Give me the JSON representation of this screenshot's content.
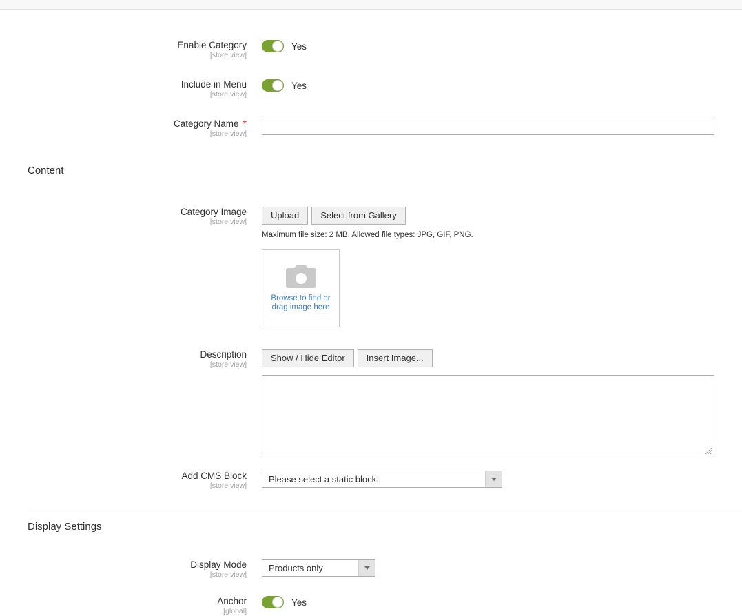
{
  "scopes": {
    "store_view": "[store view]",
    "global": "[global]"
  },
  "fields": {
    "enable_category": {
      "label": "Enable Category",
      "scope": "[store view]",
      "value": "Yes",
      "toggle_color": "#79a22e"
    },
    "include_in_menu": {
      "label": "Include in Menu",
      "scope": "[store view]",
      "value": "Yes",
      "toggle_color": "#79a22e"
    },
    "category_name": {
      "label": "Category Name",
      "scope": "[store view]",
      "required_marker": "*",
      "value": "",
      "placeholder": ""
    }
  },
  "content_section": {
    "title": "Content",
    "category_image": {
      "label": "Category Image",
      "scope": "[store view]",
      "upload_label": "Upload",
      "gallery_label": "Select from Gallery",
      "note": "Maximum file size: 2 MB. Allowed file types: JPG, GIF, PNG.",
      "dropzone_line1": "Browse to find or",
      "dropzone_line2": "drag image here",
      "dropzone_link_color": "#3a7ec8"
    },
    "description": {
      "label": "Description",
      "scope": "[store view]",
      "show_hide_editor_label": "Show / Hide Editor",
      "insert_image_label": "Insert Image...",
      "value": "",
      "placeholder": ""
    },
    "add_cms_block": {
      "label": "Add CMS Block",
      "scope": "[store view]",
      "selected": "Please select a static block."
    }
  },
  "display_settings_section": {
    "title": "Display Settings",
    "display_mode": {
      "label": "Display Mode",
      "scope": "[store view]",
      "selected": "Products only"
    },
    "anchor": {
      "label": "Anchor",
      "scope": "[global]",
      "value": "Yes",
      "toggle_color": "#79a22e"
    }
  }
}
